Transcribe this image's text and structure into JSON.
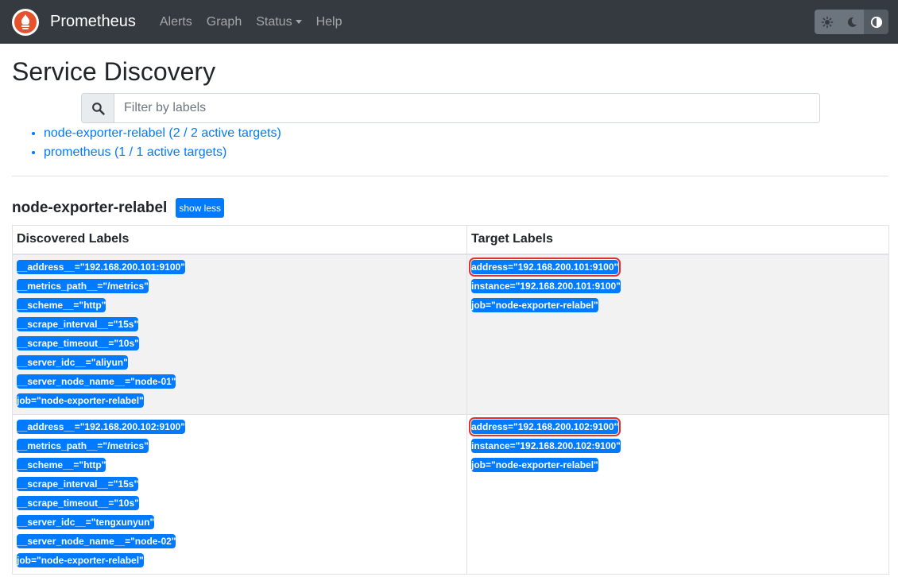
{
  "nav": {
    "brand": "Prometheus",
    "links": [
      "Alerts",
      "Graph",
      "Status",
      "Help"
    ],
    "theme_buttons": [
      "sun-icon",
      "moon-icon",
      "contrast-icon"
    ]
  },
  "page": {
    "title": "Service Discovery",
    "filter_placeholder": "Filter by labels"
  },
  "pools": [
    {
      "label": "node-exporter-relabel (2 / 2 active targets)"
    },
    {
      "label": "prometheus (1 / 1 active targets)"
    }
  ],
  "section": {
    "title": "node-exporter-relabel",
    "toggle_label": "show less",
    "headers": [
      "Discovered Labels",
      "Target Labels"
    ],
    "rows": [
      {
        "discovered": [
          "__address__=\"192.168.200.101:9100\"",
          "__metrics_path__=\"/metrics\"",
          "__scheme__=\"http\"",
          "__scrape_interval__=\"15s\"",
          "__scrape_timeout__=\"10s\"",
          "__server_idc__=\"aliyun\"",
          "__server_node_name__=\"node-01\"",
          "job=\"node-exporter-relabel\""
        ],
        "target": [
          "address=\"192.168.200.101:9100\"",
          "instance=\"192.168.200.101:9100\"",
          "job=\"node-exporter-relabel\""
        ]
      },
      {
        "discovered": [
          "__address__=\"192.168.200.102:9100\"",
          "__metrics_path__=\"/metrics\"",
          "__scheme__=\"http\"",
          "__scrape_interval__=\"15s\"",
          "__scrape_timeout__=\"10s\"",
          "__server_idc__=\"tengxunyun\"",
          "__server_node_name__=\"node-02\"",
          "job=\"node-exporter-relabel\""
        ],
        "target": [
          "address=\"192.168.200.102:9100\"",
          "instance=\"192.168.200.102:9100\"",
          "job=\"node-exporter-relabel\""
        ]
      }
    ]
  },
  "colors": {
    "navbar": "#343a40",
    "accent": "#007bff",
    "highlight_border": "#e03131"
  }
}
